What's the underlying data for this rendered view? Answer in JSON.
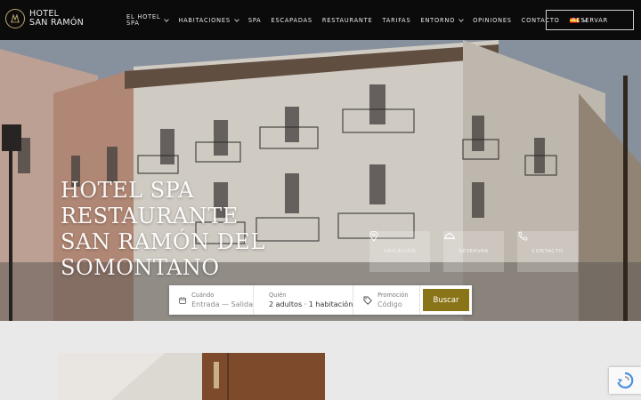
{
  "brand": {
    "line1": "HOTEL",
    "line2": "SAN RAMÓN",
    "accent": "#bfa76a"
  },
  "nav": {
    "items": [
      {
        "label_1": "EL HOTEL",
        "label_2": "SPA",
        "has_dropdown": true
      },
      {
        "label": "HABITACIONES",
        "has_dropdown": true
      },
      {
        "label": "SPA",
        "has_dropdown": false
      },
      {
        "label": "ESCAPADAS",
        "has_dropdown": false
      },
      {
        "label": "RESTAURANTE",
        "has_dropdown": false
      },
      {
        "label": "TARIFAS",
        "has_dropdown": false
      },
      {
        "label": "ENTORNO",
        "has_dropdown": true
      },
      {
        "label": "OPINIONES",
        "has_dropdown": false
      },
      {
        "label": "CONTACTO",
        "has_dropdown": false
      }
    ],
    "language_icon": "spain-flag-icon",
    "reserve_label": "RESERVAR"
  },
  "hero": {
    "title": "HOTEL SPA RESTAURANTE SAN RAMÓN DEL SOMONTANO",
    "quick_links": [
      {
        "label": "UBICACIÓN",
        "icon": "location-pin-icon"
      },
      {
        "label": "RESERVAR",
        "icon": "cloche-icon"
      },
      {
        "label": "CONTACTO",
        "icon": "phone-icon"
      }
    ]
  },
  "booking": {
    "dates": {
      "label": "Cuándo",
      "value": "Entrada — Salida",
      "icon": "calendar-icon"
    },
    "guests": {
      "label": "Quién",
      "value": "2 adultos · 1 habitación",
      "icon": "users-icon"
    },
    "promo": {
      "label": "Promoción",
      "placeholder": "Código",
      "icon": "tag-icon"
    },
    "search_label": "Buscar",
    "search_color": "#8a7418"
  }
}
